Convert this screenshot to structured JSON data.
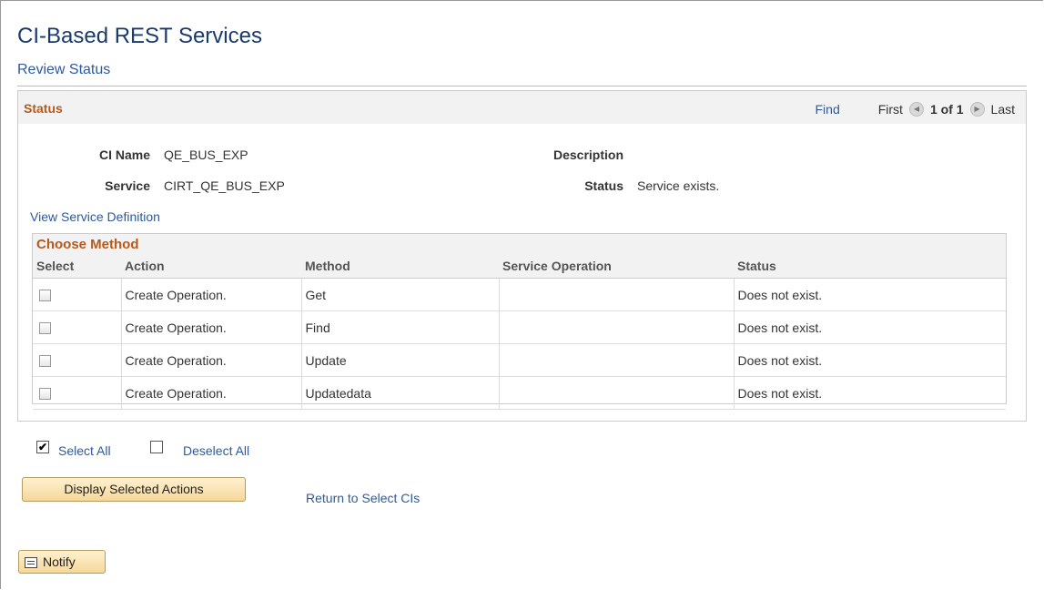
{
  "page": {
    "title": "CI-Based REST Services",
    "subtitle": "Review Status"
  },
  "status_section": {
    "title": "Status",
    "nav": {
      "find": "Find",
      "first": "First",
      "position": "1 of 1",
      "last": "Last"
    },
    "fields": {
      "ci_name_label": "CI Name",
      "ci_name_value": "QE_BUS_EXP",
      "service_label": "Service",
      "service_value": "CIRT_QE_BUS_EXP",
      "description_label": "Description",
      "status_label": "Status",
      "status_value": "Service exists."
    },
    "view_service_link": "View Service Definition"
  },
  "method_grid": {
    "title": "Choose Method",
    "columns": [
      "Select",
      "Action",
      "Method",
      "Service Operation",
      "Status"
    ],
    "rows": [
      {
        "selected": false,
        "action": "Create Operation.",
        "method": "Get",
        "service_operation": "",
        "status": "Does not exist."
      },
      {
        "selected": false,
        "action": "Create Operation.",
        "method": "Find",
        "service_operation": "",
        "status": "Does not exist."
      },
      {
        "selected": false,
        "action": "Create Operation.",
        "method": "Update",
        "service_operation": "",
        "status": "Does not exist."
      },
      {
        "selected": false,
        "action": "Create Operation.",
        "method": "Updatedata",
        "service_operation": "",
        "status": "Does not exist."
      }
    ]
  },
  "actions": {
    "select_all": "Select All",
    "deselect_all": "Deselect All",
    "display_selected": "Display Selected Actions",
    "return_link": "Return to Select CIs",
    "notify": "Notify"
  },
  "colors": {
    "title": "#1a3a6e",
    "link": "#2d5a9e",
    "section_title": "#b55a1c",
    "button_bg": "#f5d79a"
  }
}
